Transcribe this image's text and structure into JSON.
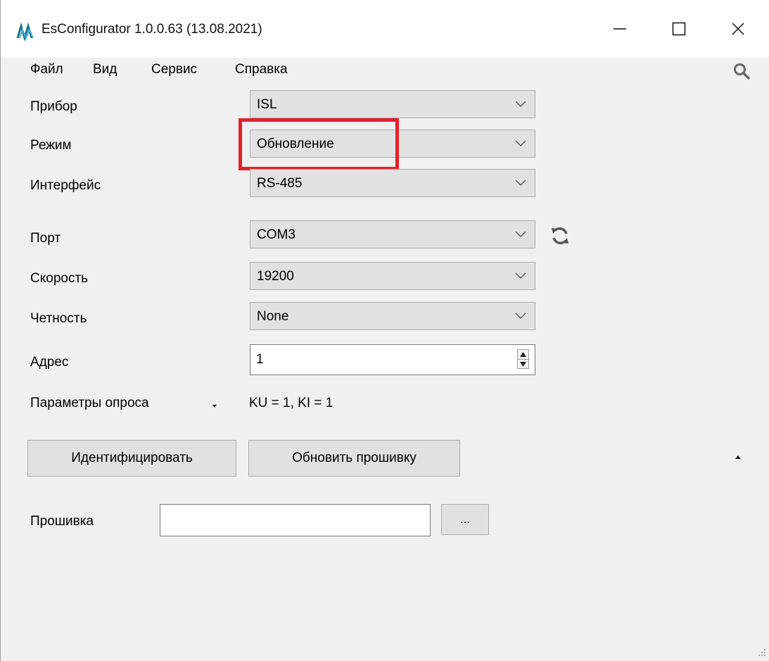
{
  "window": {
    "title": "EsConfigurator 1.0.0.63 (13.08.2021)"
  },
  "menu": {
    "items": [
      "Файл",
      "Вид",
      "Сервис",
      "Справка"
    ]
  },
  "form": {
    "device": {
      "label": "Прибор",
      "value": "ISL"
    },
    "mode": {
      "label": "Режим",
      "value": "Обновление"
    },
    "interface": {
      "label": "Интерфейс",
      "value": "RS-485"
    },
    "port": {
      "label": "Порт",
      "value": "COM3"
    },
    "speed": {
      "label": "Скорость",
      "value": "19200"
    },
    "parity": {
      "label": "Четность",
      "value": "None"
    },
    "address": {
      "label": "Адрес",
      "value": "1"
    },
    "poll": {
      "label": "Параметры опроса",
      "value": "KU = 1, KI = 1"
    }
  },
  "buttons": {
    "identify": "Идентифицировать",
    "update_firmware": "Обновить прошивку",
    "browse": "..."
  },
  "firmware": {
    "label": "Прошивка",
    "value": ""
  },
  "colors": {
    "highlight": "#e5202a",
    "app_icon": "#1f6f8b"
  }
}
